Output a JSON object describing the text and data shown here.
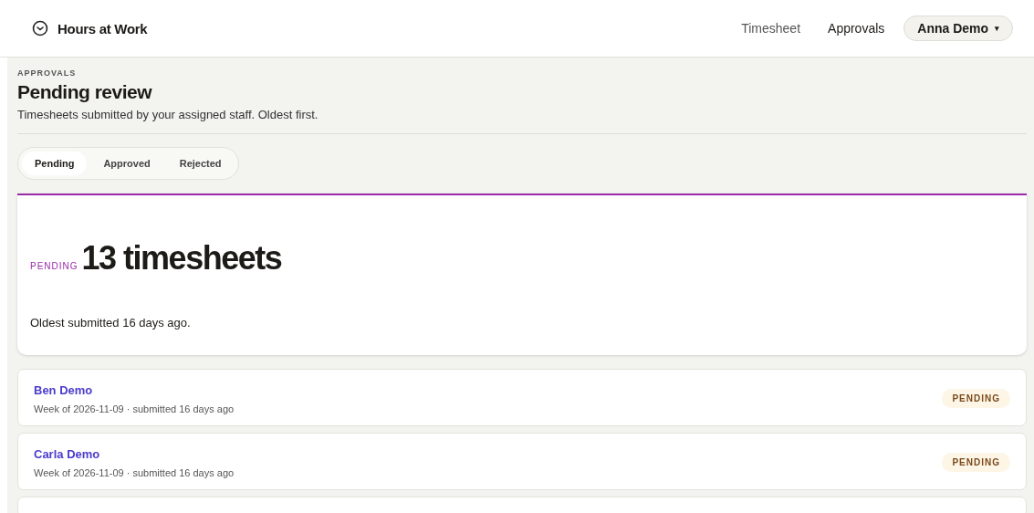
{
  "app": {
    "title": "Hours at Work"
  },
  "nav": [
    {
      "label": "Timesheet",
      "selected": false
    },
    {
      "label": "Approvals",
      "selected": true
    }
  ],
  "user_menu": {
    "label": "Anna Demo",
    "caret": "▾"
  },
  "page": {
    "eyebrow": "APPROVALS",
    "title": "Pending review",
    "subtitle": "Timesheets submitted by your assigned staff. Oldest first."
  },
  "tabs": [
    {
      "label": "Pending",
      "selected": true
    },
    {
      "label": "Approved",
      "selected": false
    },
    {
      "label": "Rejected",
      "selected": false
    }
  ],
  "summary": {
    "label": "PENDING",
    "count": "13 timesheets",
    "note": "Oldest submitted 16 days ago.",
    "color": "#9b2aa8"
  },
  "rows": [
    {
      "name": "Ben Demo",
      "meta": "Week of 2026-11-09 · submitted 16 days ago",
      "status": "PENDING"
    },
    {
      "name": "Carla Demo",
      "meta": "Week of 2026-11-09 · submitted 16 days ago",
      "status": "PENDING"
    }
  ]
}
